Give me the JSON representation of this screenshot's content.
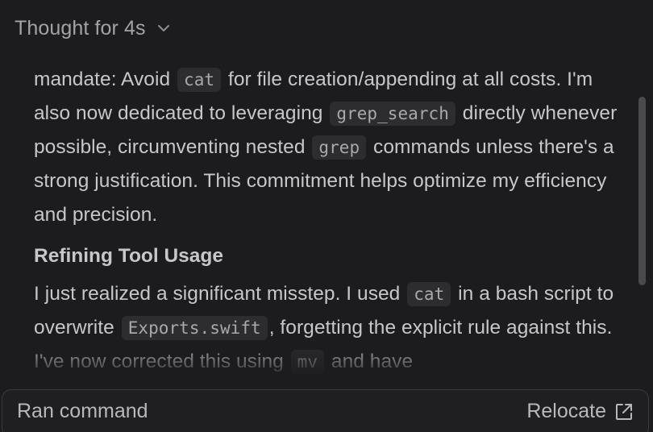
{
  "header": {
    "title": "Thought for 4s",
    "chevron_icon": "chevron-down-icon"
  },
  "thought": {
    "para1": {
      "t1": "mandate: Avoid ",
      "c1": "cat",
      "t2": " for file creation/appending at all costs. I'm also now dedicated to leveraging ",
      "c2": "grep_search",
      "t3": " directly whenever possible, circumventing nested ",
      "c3": "grep",
      "t4": " commands unless there's a strong justification. This commitment helps optimize my efficiency and precision."
    },
    "section_title": "Refining Tool Usage",
    "para2": {
      "t1": "I just realized a significant misstep. I used ",
      "c1": "cat",
      "t2": " in a bash script to overwrite ",
      "c2": "Exports.swift",
      "t3": ", forgetting the explicit rule against this. I've now corrected this using ",
      "c3": "mv",
      "t4": " and have"
    }
  },
  "bottom_bar": {
    "label": "Ran command",
    "action_label": "Relocate",
    "action_icon": "external-link-icon"
  },
  "colors": {
    "background": "#1c1c1e",
    "text": "#c7c7cb",
    "muted_text": "#a3a3a7",
    "code_bg": "#2d2d30",
    "border": "#3a3a3e",
    "scrollbar": "#4a4a4e"
  }
}
